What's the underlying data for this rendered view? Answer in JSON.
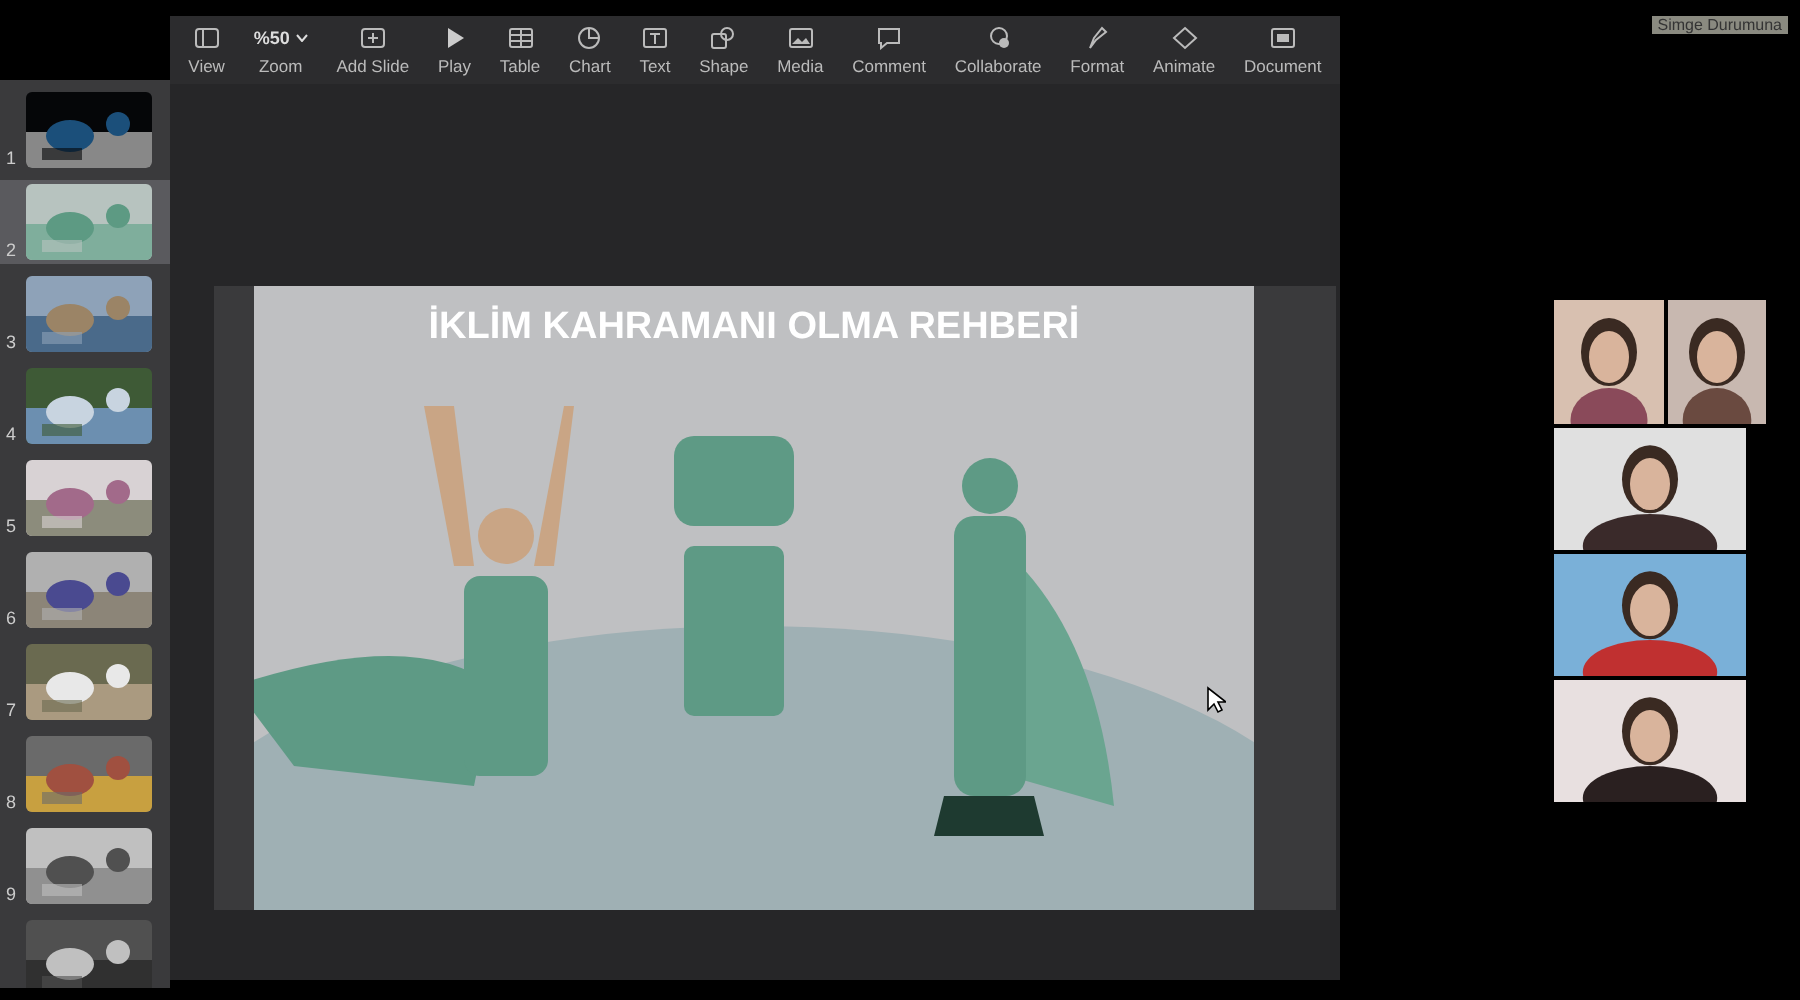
{
  "toolbar": [
    {
      "kind": "view",
      "label": "View"
    },
    {
      "kind": "zoom",
      "label": "Zoom",
      "value": "%50"
    },
    {
      "kind": "add",
      "label": "Add Slide"
    },
    {
      "kind": "play",
      "label": "Play"
    },
    {
      "kind": "table",
      "label": "Table"
    },
    {
      "kind": "chart",
      "label": "Chart"
    },
    {
      "kind": "text",
      "label": "Text"
    },
    {
      "kind": "shape",
      "label": "Shape"
    },
    {
      "kind": "media",
      "label": "Media"
    },
    {
      "kind": "comment",
      "label": "Comment"
    },
    {
      "kind": "collab",
      "label": "Collaborate"
    },
    {
      "kind": "format",
      "label": "Format"
    },
    {
      "kind": "animate",
      "label": "Animate"
    },
    {
      "kind": "document",
      "label": "Document"
    }
  ],
  "slides": [
    {
      "number": "1",
      "selected": false,
      "kind": "picture"
    },
    {
      "number": "2",
      "selected": true,
      "kind": "picture"
    },
    {
      "number": "3",
      "selected": false,
      "kind": "picture"
    },
    {
      "number": "4",
      "selected": false,
      "kind": "picture"
    },
    {
      "number": "5",
      "selected": false,
      "kind": "picture"
    },
    {
      "number": "6",
      "selected": false,
      "kind": "picture"
    },
    {
      "number": "7",
      "selected": false,
      "kind": "picture"
    },
    {
      "number": "8",
      "selected": false,
      "kind": "picture"
    },
    {
      "number": "9",
      "selected": false,
      "kind": "picture"
    },
    {
      "selected": false,
      "kind": "picture"
    }
  ],
  "slide": {
    "title": "İKLİM KAHRAMANI OLMA REHBERİ",
    "kind": "picture"
  },
  "minimize_button": "Simge Durumuna",
  "participants": [
    {
      "kind": "picture"
    },
    {
      "kind": "picture"
    },
    {
      "kind": "picture"
    },
    {
      "kind": "picture"
    },
    {
      "kind": "picture"
    }
  ]
}
